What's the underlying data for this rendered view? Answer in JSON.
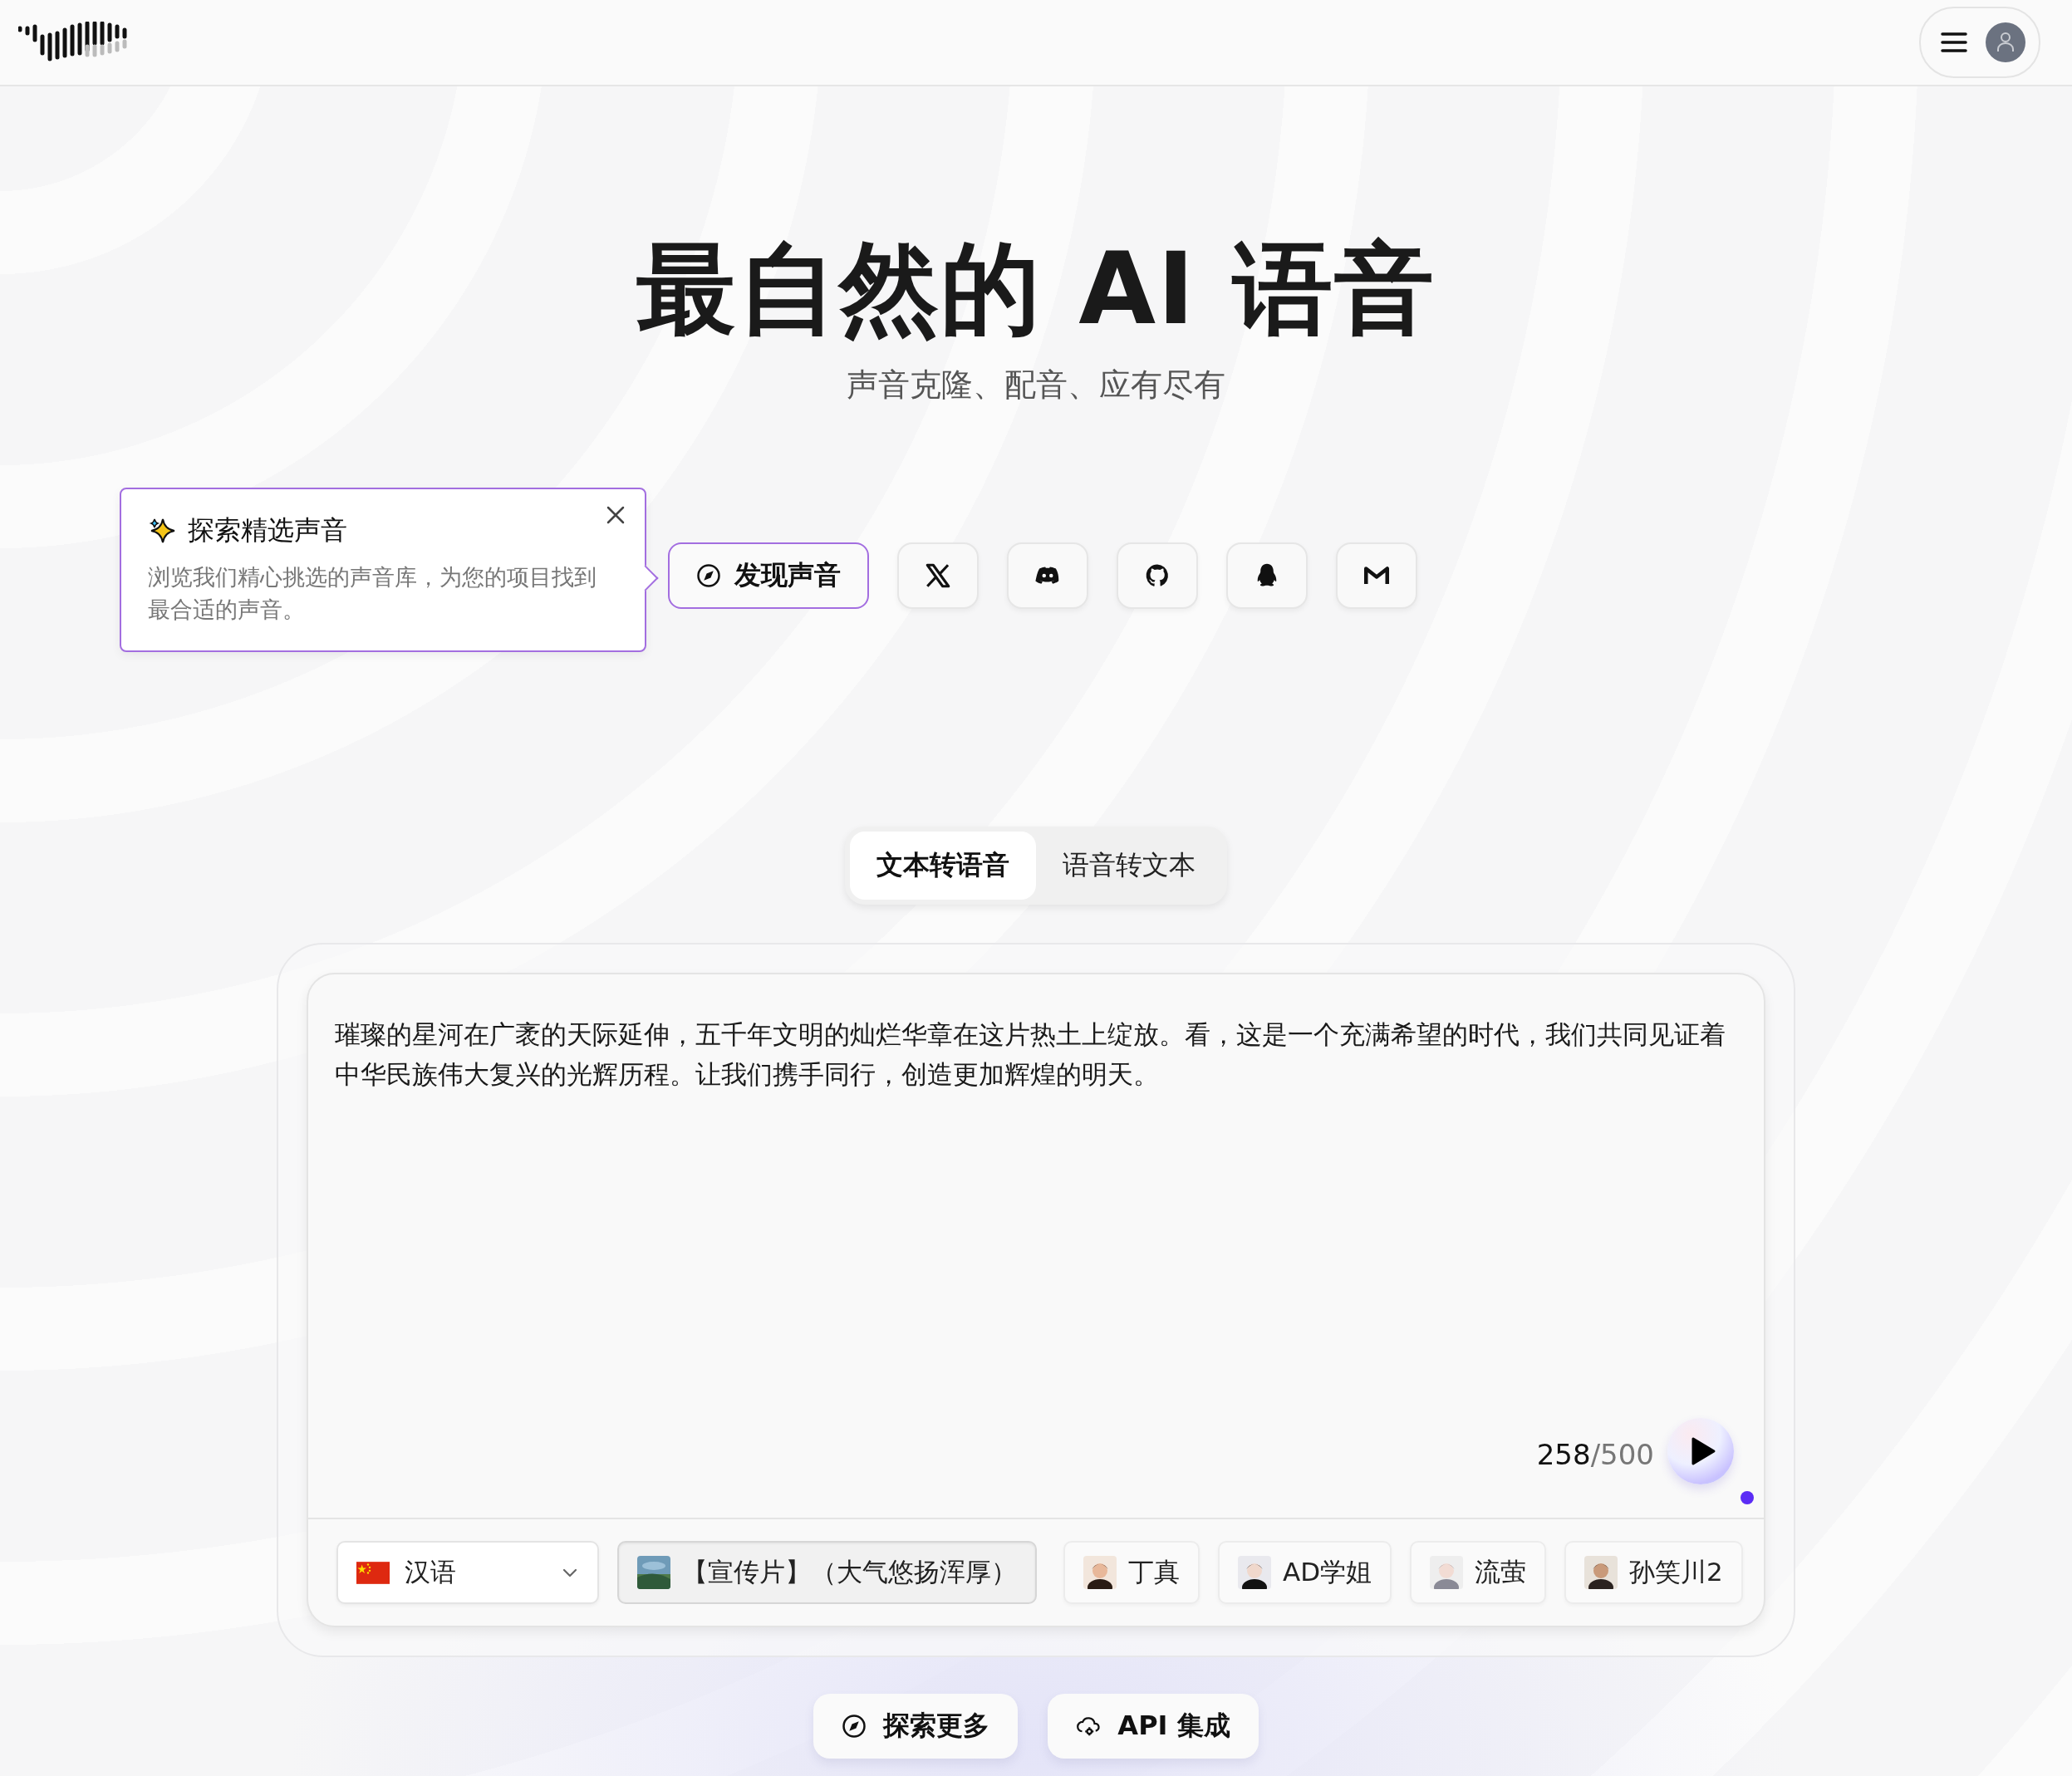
{
  "hero": {
    "title": "最自然的 AI 语音",
    "subtitle": "声音克隆、配音、应有尽有"
  },
  "tooltip": {
    "title": "探索精选声音",
    "text": "浏览我们精心挑选的声音库，为您的项目找到最合适的声音。"
  },
  "discover_button": {
    "label": "发现声音"
  },
  "social_links": [
    {
      "kind": "x"
    },
    {
      "kind": "discord"
    },
    {
      "kind": "github"
    },
    {
      "kind": "qq"
    },
    {
      "kind": "mail"
    }
  ],
  "mode_tabs": [
    {
      "label": "文本转语音",
      "selected": true
    },
    {
      "label": "语音转文本",
      "selected": false
    }
  ],
  "editor": {
    "text": "璀璨的星河在广袤的天际延伸，五千年文明的灿烂华章在这片热土上绽放。看，这是一个充满希望的时代，我们共同见证着中华民族伟大复兴的光辉历程。让我们携手同行，创造更加辉煌的明天。",
    "count": "258",
    "limit": "/500"
  },
  "language": {
    "label": "汉语"
  },
  "voices": [
    {
      "name": "【宣传片】（大气悠扬浑厚）",
      "selected": true
    },
    {
      "name": "丁真",
      "selected": false
    },
    {
      "name": "AD学姐",
      "selected": false
    },
    {
      "name": "流萤",
      "selected": false
    },
    {
      "name": "孙笑川2",
      "selected": false
    }
  ],
  "actions": [
    {
      "label": "探索更多",
      "kind": "explore"
    },
    {
      "label": "API 集成",
      "kind": "api"
    }
  ]
}
